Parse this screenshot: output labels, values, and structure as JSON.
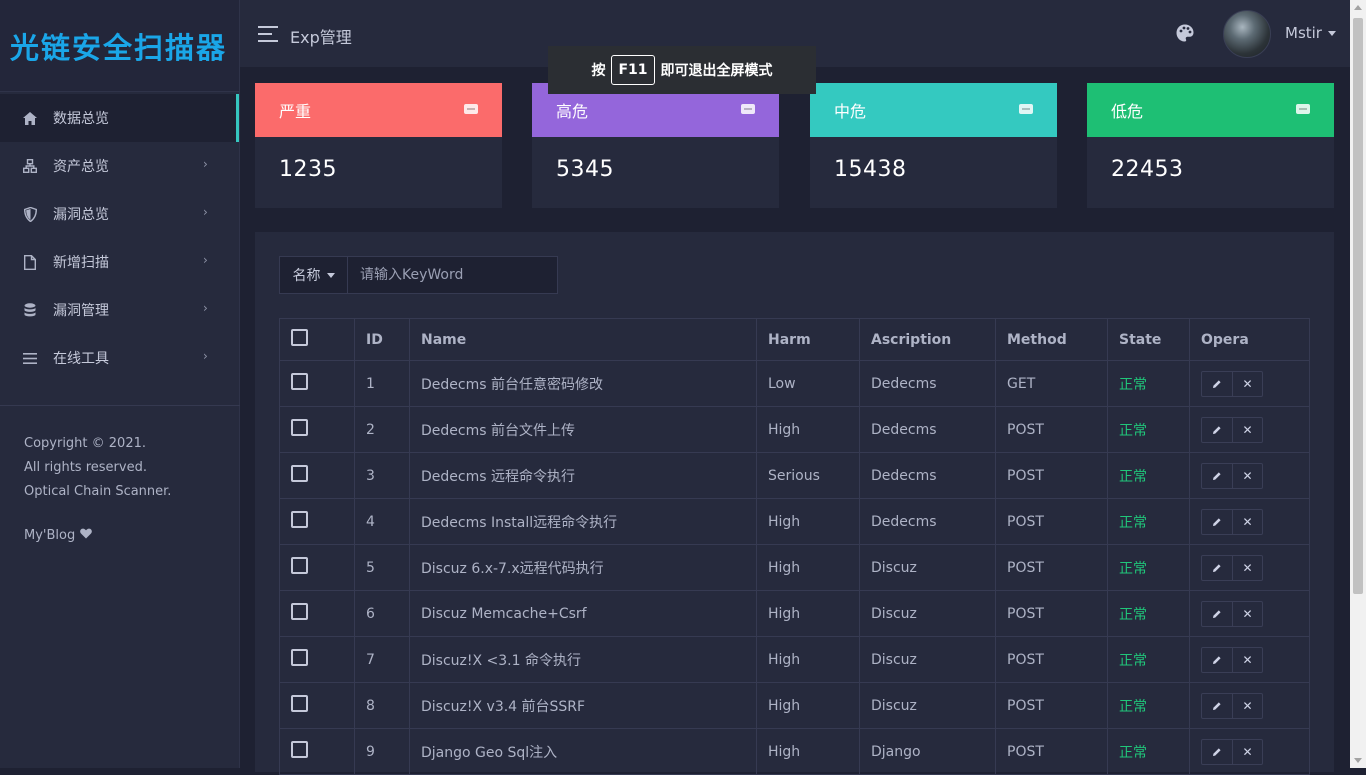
{
  "sidebar": {
    "logo": "光链安全扫描器",
    "items": [
      {
        "label": "数据总览",
        "icon": "home-icon"
      },
      {
        "label": "资产总览",
        "icon": "sitemap-icon"
      },
      {
        "label": "漏洞总览",
        "icon": "shield-icon"
      },
      {
        "label": "新增扫描",
        "icon": "file-icon"
      },
      {
        "label": "漏洞管理",
        "icon": "database-icon"
      },
      {
        "label": "在线工具",
        "icon": "list-icon"
      }
    ],
    "copyright": [
      "Copyright © 2021.",
      "All rights reserved.",
      "Optical Chain Scanner."
    ],
    "blog": "My'Blog"
  },
  "header": {
    "title": "Exp管理",
    "user": "Mstir"
  },
  "toast": {
    "prefix": "按",
    "key": "F11",
    "suffix": "即可退出全屏模式"
  },
  "cards": [
    {
      "label": "严重",
      "value": "1235",
      "color": "#fb6b6b"
    },
    {
      "label": "高危",
      "value": "5345",
      "color": "#9466db"
    },
    {
      "label": "中危",
      "value": "15438",
      "color": "#34c9c0"
    },
    {
      "label": "低危",
      "value": "22453",
      "color": "#1ebf74"
    }
  ],
  "search": {
    "select_label": "名称",
    "placeholder": "请输入KeyWord"
  },
  "table": {
    "headers": [
      "ID",
      "Name",
      "Harm",
      "Ascription",
      "Method",
      "State",
      "Opera"
    ],
    "rows": [
      {
        "id": "1",
        "name": "Dedecms 前台任意密码修改",
        "harm": "Low",
        "ascription": "Dedecms",
        "method": "GET",
        "state": "正常"
      },
      {
        "id": "2",
        "name": "Dedecms 前台文件上传",
        "harm": "High",
        "ascription": "Dedecms",
        "method": "POST",
        "state": "正常"
      },
      {
        "id": "3",
        "name": "Dedecms 远程命令执行",
        "harm": "Serious",
        "ascription": "Dedecms",
        "method": "POST",
        "state": "正常"
      },
      {
        "id": "4",
        "name": "Dedecms Install远程命令执行",
        "harm": "High",
        "ascription": "Dedecms",
        "method": "POST",
        "state": "正常"
      },
      {
        "id": "5",
        "name": "Discuz 6.x-7.x远程代码执行",
        "harm": "High",
        "ascription": "Discuz",
        "method": "POST",
        "state": "正常"
      },
      {
        "id": "6",
        "name": "Discuz Memcache+Csrf",
        "harm": "High",
        "ascription": "Discuz",
        "method": "POST",
        "state": "正常"
      },
      {
        "id": "7",
        "name": "Discuz!X <3.1 命令执行",
        "harm": "High",
        "ascription": "Discuz",
        "method": "POST",
        "state": "正常"
      },
      {
        "id": "8",
        "name": "Discuz!X v3.4 前台SSRF",
        "harm": "High",
        "ascription": "Discuz",
        "method": "POST",
        "state": "正常"
      },
      {
        "id": "9",
        "name": "Django Geo Sql注入",
        "harm": "High",
        "ascription": "Django",
        "method": "POST",
        "state": "正常"
      }
    ]
  }
}
